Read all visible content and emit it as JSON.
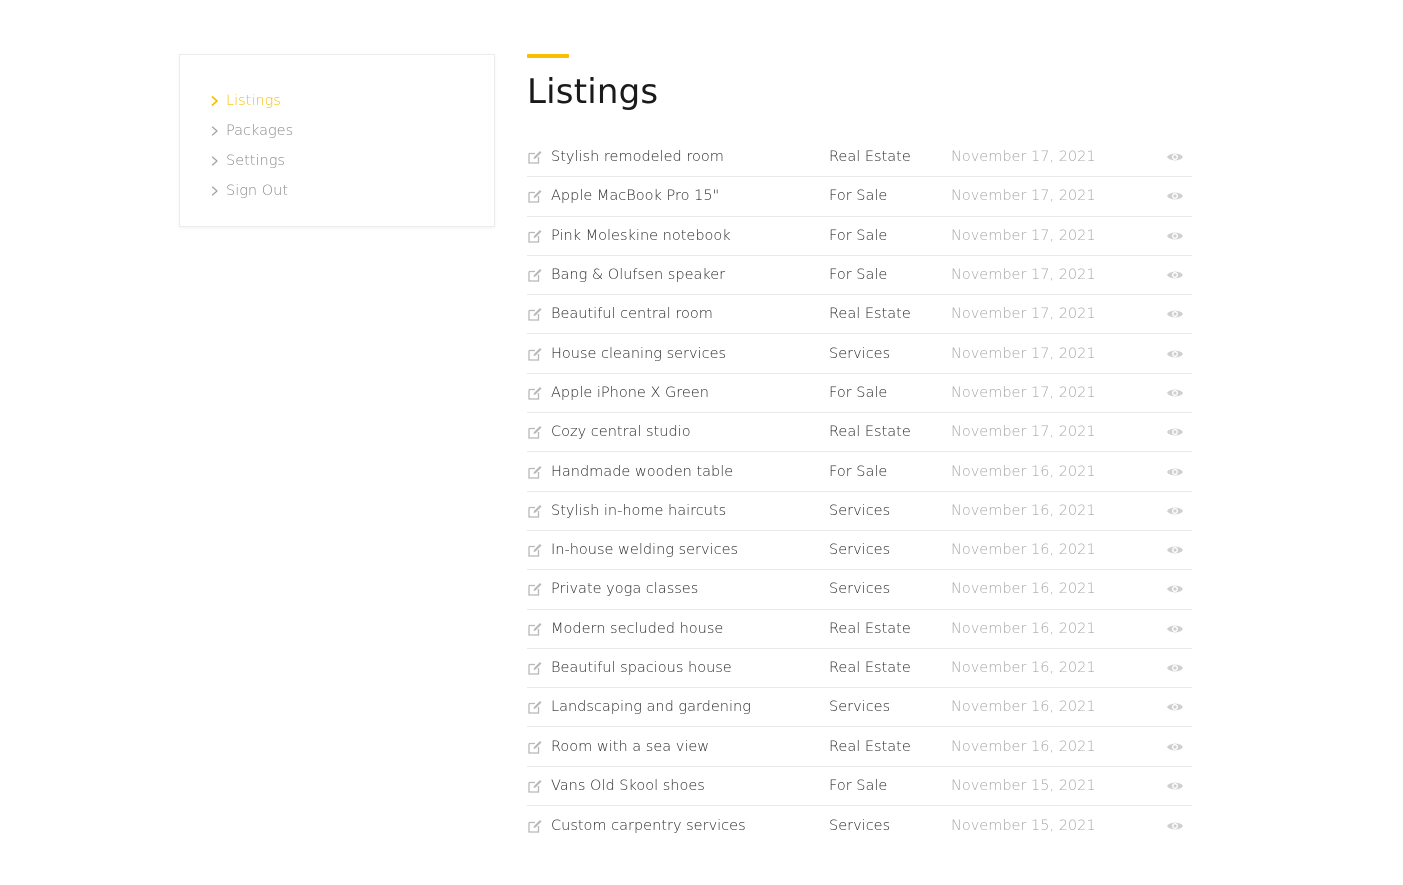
{
  "accent_color": "#f8c000",
  "sidebar": {
    "items": [
      {
        "label": "Listings",
        "active": true,
        "icon": "chevron-right-icon"
      },
      {
        "label": "Packages",
        "active": false,
        "icon": "chevron-right-icon"
      },
      {
        "label": "Settings",
        "active": false,
        "icon": "chevron-right-icon"
      },
      {
        "label": "Sign Out",
        "active": false,
        "icon": "chevron-right-icon"
      }
    ]
  },
  "main": {
    "title": "Listings",
    "listings": [
      {
        "title": "Stylish remodeled room",
        "category": "Real Estate",
        "date": "November 17, 2021"
      },
      {
        "title": "Apple MacBook Pro 15\"",
        "category": "For Sale",
        "date": "November 17, 2021"
      },
      {
        "title": "Pink Moleskine notebook",
        "category": "For Sale",
        "date": "November 17, 2021"
      },
      {
        "title": "Bang & Olufsen speaker",
        "category": "For Sale",
        "date": "November 17, 2021"
      },
      {
        "title": "Beautiful central room",
        "category": "Real Estate",
        "date": "November 17, 2021"
      },
      {
        "title": "House cleaning services",
        "category": "Services",
        "date": "November 17, 2021"
      },
      {
        "title": "Apple iPhone X Green",
        "category": "For Sale",
        "date": "November 17, 2021"
      },
      {
        "title": "Cozy central studio",
        "category": "Real Estate",
        "date": "November 17, 2021"
      },
      {
        "title": "Handmade wooden table",
        "category": "For Sale",
        "date": "November 16, 2021"
      },
      {
        "title": "Stylish in-home haircuts",
        "category": "Services",
        "date": "November 16, 2021"
      },
      {
        "title": "In-house welding services",
        "category": "Services",
        "date": "November 16, 2021"
      },
      {
        "title": "Private yoga classes",
        "category": "Services",
        "date": "November 16, 2021"
      },
      {
        "title": "Modern secluded house",
        "category": "Real Estate",
        "date": "November 16, 2021"
      },
      {
        "title": "Beautiful spacious house",
        "category": "Real Estate",
        "date": "November 16, 2021"
      },
      {
        "title": "Landscaping and gardening",
        "category": "Services",
        "date": "November 16, 2021"
      },
      {
        "title": "Room with a sea view",
        "category": "Real Estate",
        "date": "November 16, 2021"
      },
      {
        "title": "Vans Old Skool shoes",
        "category": "For Sale",
        "date": "November 15, 2021"
      },
      {
        "title": "Custom carpentry services",
        "category": "Services",
        "date": "November 15, 2021"
      }
    ]
  }
}
